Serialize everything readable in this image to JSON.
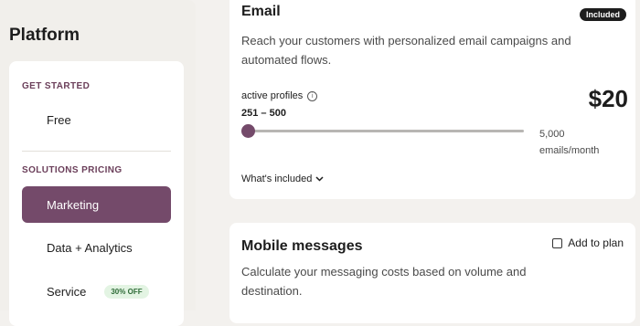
{
  "sidebar": {
    "title": "Platform",
    "get_started_label": "GET STARTED",
    "free_label": "Free",
    "solutions_label": "SOLUTIONS PRICING",
    "items": [
      {
        "label": "Marketing",
        "active": true
      },
      {
        "label": "Data + Analytics",
        "active": false
      },
      {
        "label": "Service",
        "active": false,
        "badge": "30% OFF"
      }
    ]
  },
  "email_card": {
    "title": "Email",
    "badge": "Included",
    "description": "Reach your customers with personalized email campaigns and automated flows.",
    "profiles_label": "active profiles",
    "range_label": "251 – 500",
    "price": "$20",
    "max_value": "5,000",
    "max_unit": "emails/month",
    "whats_included": "What's included",
    "slider_value_fraction": 0
  },
  "mobile_card": {
    "title": "Mobile messages",
    "add_to_plan": "Add to plan",
    "description": "Calculate your messaging costs based on volume and destination."
  },
  "colors": {
    "accent": "#744a6a",
    "badge_green_bg": "#e3f4e3",
    "badge_green_text": "#2e6b37"
  }
}
